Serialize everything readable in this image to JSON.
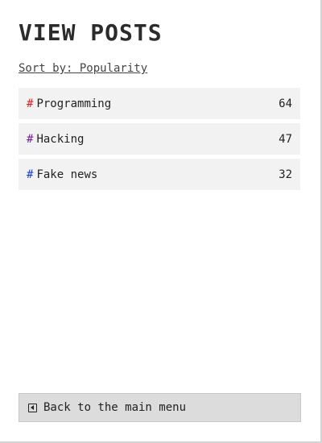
{
  "page": {
    "title": "VIEW POSTS",
    "sort_label": "Sort by: Popularity"
  },
  "tags": [
    {
      "hash": "#",
      "name": "Programming",
      "count": "64",
      "hash_color": "#e02424"
    },
    {
      "hash": "#",
      "name": "Hacking",
      "count": "47",
      "hash_color": "#7a1fa2"
    },
    {
      "hash": "#",
      "name": "Fake news",
      "count": "32",
      "hash_color": "#1a3fd6"
    }
  ],
  "footer": {
    "back_label": "Back to the main menu",
    "back_icon": "back-arrow-icon"
  }
}
